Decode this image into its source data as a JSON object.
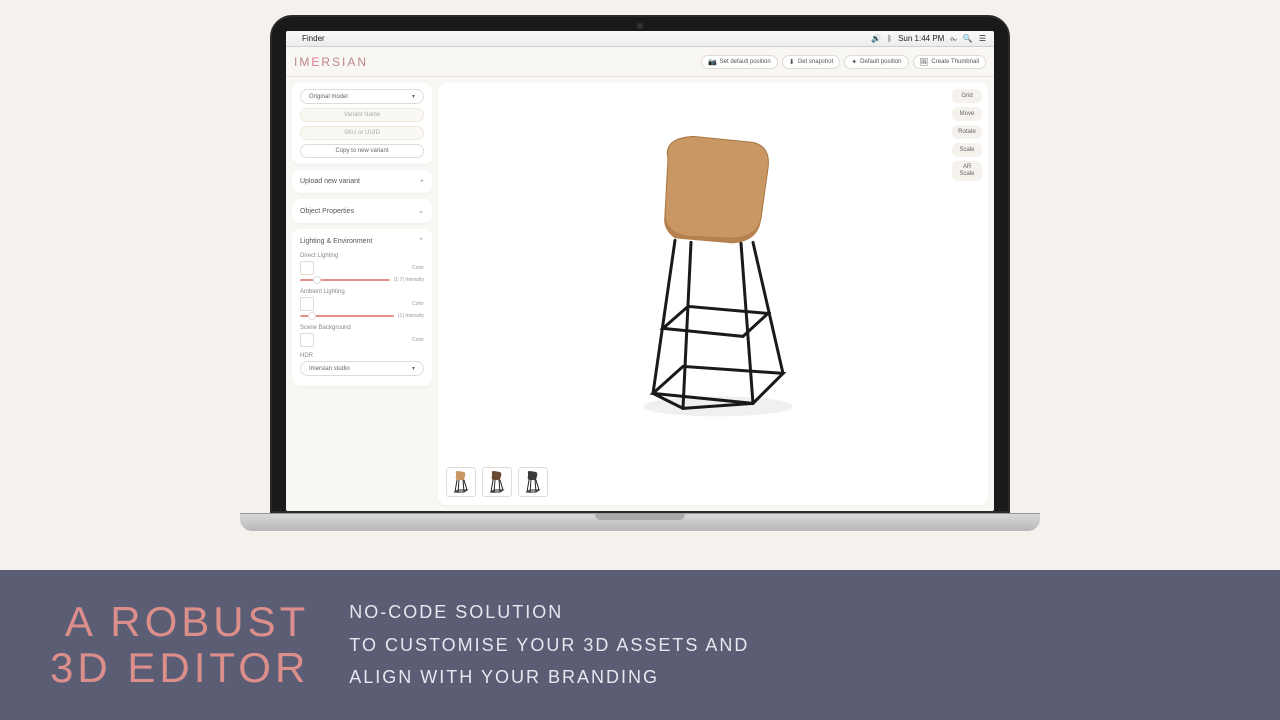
{
  "macbar": {
    "app": "Finder",
    "time": "Sun 1:44 PM"
  },
  "brand": "IMERSIAN",
  "header_actions": {
    "set_default": "Set default position",
    "snapshot": "Get snapshot",
    "default_pos": "Default position",
    "thumbnail": "Create Thumbnail"
  },
  "sidebar": {
    "model_dropdown": "Original model",
    "variant_name_placeholder": "Variant Name",
    "sku_placeholder": "SKU or UUID",
    "copy_variant": "Copy to new variant",
    "upload_variant": "Upload new variant",
    "object_props": "Object Properties",
    "lighting_env": "Lighting & Environment",
    "direct_lighting": "Direct Lighting",
    "color_label": "Color",
    "direct_intensity": "(1.7) Intensity",
    "ambient_lighting": "Ambient Lighting",
    "ambient_intensity": "(1) Intensity",
    "scene_bg": "Scene Background",
    "hdr": "HDR",
    "hdr_value": "Imersian studio"
  },
  "tools": {
    "grid": "Grid",
    "move": "Move",
    "rotate": "Rotate",
    "scale": "Scale",
    "ar_scale_1": "AR",
    "ar_scale_2": "Scale"
  },
  "thumbnails": {
    "colors": [
      "#c99764",
      "#6b4a35",
      "#3a3a3a"
    ]
  },
  "promo": {
    "title_1": "A ROBUST",
    "title_2": "3D EDITOR",
    "line_1": "NO-CODE SOLUTION",
    "line_2": "TO CUSTOMISE YOUR 3D ASSETS AND",
    "line_3": "ALIGN WITH YOUR BRANDING"
  }
}
